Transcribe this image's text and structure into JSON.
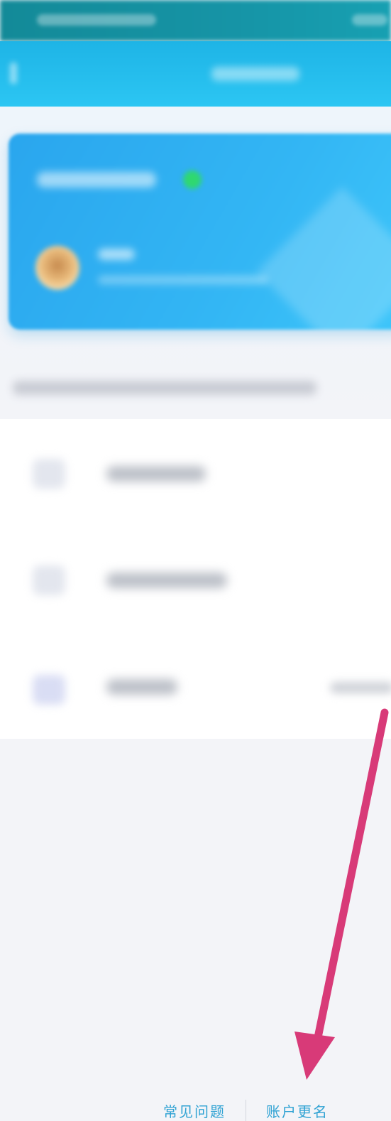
{
  "footer": {
    "faq_label": "常见问题",
    "rename_label": "账户更名"
  },
  "colors": {
    "navbar": "#1eb4e6",
    "card": "#2aa6ee",
    "footer_link": "#2fa2d3",
    "annotation_arrow": "#d83a78",
    "status_dot": "#2fd86f"
  },
  "icons": {
    "back": "chevron-left-icon",
    "person": "person-icon",
    "id_card": "id-card-icon",
    "bank_card": "bank-card-icon"
  }
}
